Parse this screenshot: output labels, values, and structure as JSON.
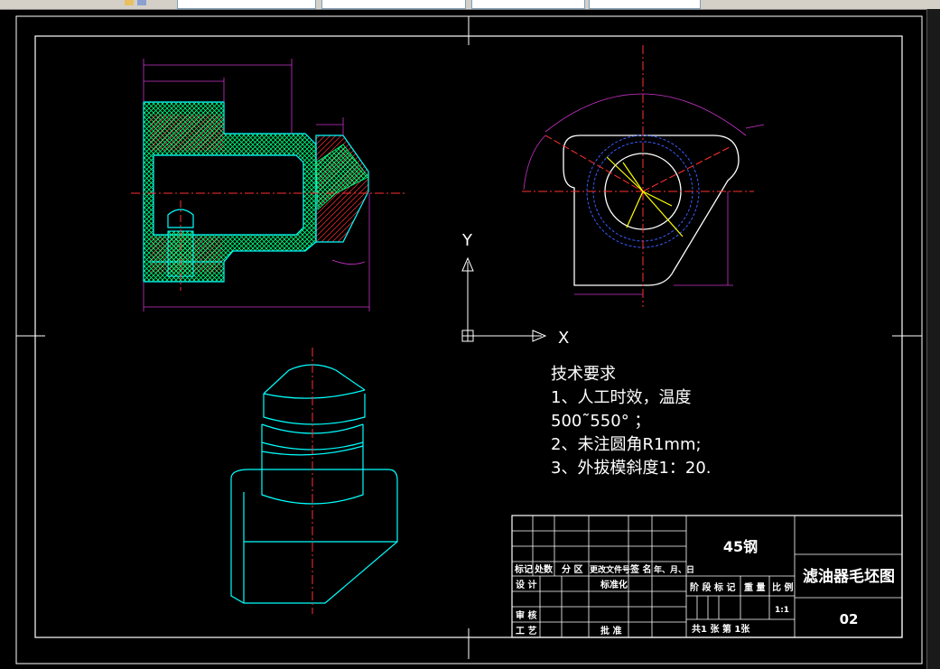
{
  "toolbar": {
    "fields": [
      "",
      "",
      "",
      ""
    ]
  },
  "ucs": {
    "y_label": "Y",
    "x_label": "X"
  },
  "tech": {
    "title": "技术要求",
    "line1": "1、人工时效，温度",
    "line2": "500˜550°  ；",
    "line3": "2、未注圆角R1mm;",
    "line4": "3、外拔模斜度1：20."
  },
  "title_block": {
    "material": "45钢",
    "drawing_name": "滤油器毛坯图",
    "drawing_number": "02",
    "h_biaoji": "标记",
    "h_chushu": "处数",
    "h_fenqu": "分 区",
    "h_gengai": "更改文件号",
    "h_qianming": "签 名",
    "h_riqi": "年、月、日",
    "sheji": "设 计",
    "biaozhunhua": "标准化",
    "shenhe": "审 核",
    "gongyi": "工 艺",
    "pizhun": "批 准",
    "jieduan": "阶 段 标 记",
    "zhongliang": "重 量",
    "bili": "比 例",
    "scale": "1:1",
    "sheets": "共1  张   第  1张"
  },
  "colors": {
    "background": "#000000",
    "outline": "#00ffff",
    "hatch_green": "#00ff80",
    "dimension": "#cc33cc",
    "centerline": "#ff3030",
    "blue_circle": "#3a5cff",
    "yellow": "#ffff00"
  }
}
